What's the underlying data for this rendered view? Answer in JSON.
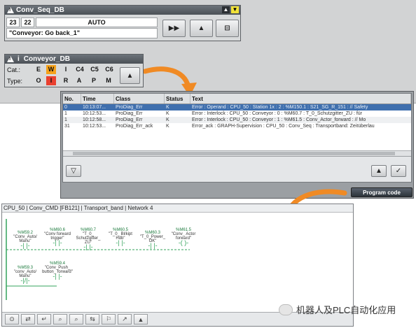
{
  "conv_seq": {
    "title": "Conv_Seq_DB",
    "step_a": "23",
    "step_b": "22",
    "mode": "AUTO",
    "message": "\"Conveyor: Go back_1\"",
    "btn_step": "▶▶",
    "btn_warn": "▲",
    "btn_close": "⊟"
  },
  "conveyor": {
    "title": "Conveyor_DB",
    "info_glyph": "i",
    "cat_label": "Cat.:",
    "type_label": "Type:",
    "categories": [
      "E",
      "W",
      "I",
      "C4",
      "C5",
      "C6"
    ],
    "types": [
      "O",
      "I",
      "R",
      "A",
      "P",
      "M"
    ],
    "colors": {
      "W": "#f5a21b",
      "I": "#e9402f"
    },
    "btn_warn": "▲"
  },
  "alarm_table": {
    "columns": [
      "No.",
      "Time",
      "Class",
      "Status",
      "Text"
    ],
    "rows": [
      {
        "no": "0",
        "time": "10:13:07...",
        "class": "ProDiag_Err",
        "status": "K",
        "text": "Error : Operand : CPU_50 : Station 1x : 2 : %M150.1 : S21_SG_R_151 : // Safety"
      },
      {
        "no": "1",
        "time": "10:12:53...",
        "class": "ProDiag_Err",
        "status": "K",
        "text": "Error : Interlock : CPU_50 : Conveyor : 0 : %M60.7 : T_0_Schutzgitter_ZU : für"
      },
      {
        "no": "1",
        "time": "10:12:58...",
        "class": "ProDiag_Err",
        "status": "K",
        "text": "Error : Interlock : CPU_50 : Conveyor : 1 : %M61.5 : Conv_Actor_forward : // Mo"
      },
      {
        "no": "31",
        "time": "10:12:53...",
        "class": "ProDiag_Err_ack",
        "status": "K",
        "text": "Error_ack : GRAPH-Supervision : CPU_50 : Conv_Seq : Transportband: Zeitüberlau"
      }
    ],
    "btn_filter": "▽",
    "btn_info": "▲",
    "btn_ack": "✓",
    "program_code_label": "Program code"
  },
  "program_view": {
    "breadcrumb": "CPU_50 | Conv_CMD [FB121] | Transport_band | Network 4",
    "contacts_row1": [
      {
        "addr": "%M59.2",
        "name": "\"Conv_Auto/ Manu\""
      },
      {
        "addr": "%M60.6",
        "name": "\"Conv forward trigger\""
      },
      {
        "addr": "%M60.7",
        "name": "\"T_0_ Schutzgitter_ ZU\""
      },
      {
        "addr": "%M60.5",
        "name": "\"T_0_ Bl/kipt Hdb\""
      },
      {
        "addr": "%M60.3",
        "name": "\"T_0_Power_ OK\""
      },
      {
        "addr": "%M61.5",
        "name": "\"Conv_ Actor forward\""
      }
    ],
    "contacts_row2": [
      {
        "addr": "%M59.3",
        "name": "\"conv_Auto/ Manu\""
      },
      {
        "addr": "%M59.4",
        "name": "\"Conv_Push_ button_ forward\""
      }
    ],
    "toolbar_icons": [
      "⊙",
      "⇄",
      "↵",
      "⌕",
      "⌕",
      "⇆",
      "⚐",
      "↗",
      "▲"
    ]
  },
  "watermark": "机器人及PLC自动化应用"
}
